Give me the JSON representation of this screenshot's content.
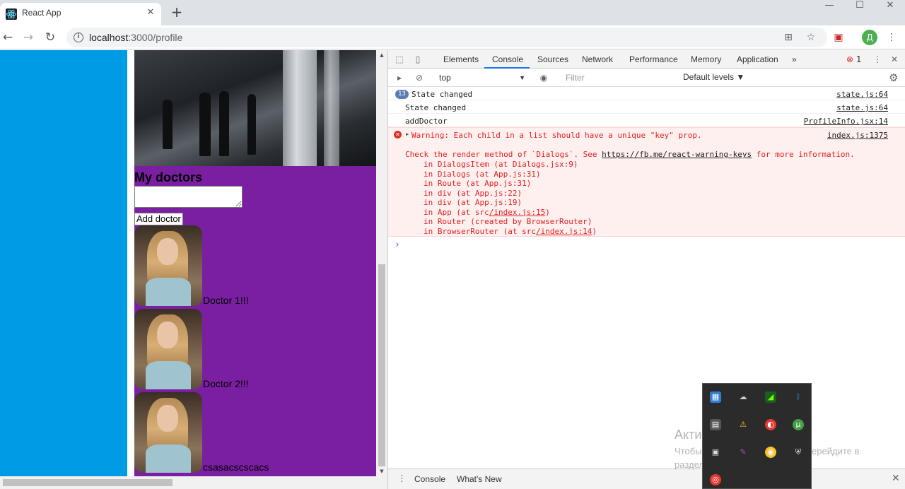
{
  "browser": {
    "tab_title": "React App",
    "tab_close": "✕",
    "new_tab": "+",
    "window_controls": [
      "—",
      "☐",
      "✕"
    ],
    "url_host": "localhost",
    "url_path": ":3000/profile",
    "info_icon": "i",
    "avatar_letter": "Д"
  },
  "page": {
    "title": "My doctors",
    "add_button": "Add doctor",
    "doctors": [
      {
        "name": "Doctor 1!!!"
      },
      {
        "name": "Doctor 2!!!"
      },
      {
        "name": "csasacscscacs"
      }
    ]
  },
  "devtools": {
    "tabs": [
      "Elements",
      "Console",
      "Sources",
      "Network",
      "Performance",
      "Memory",
      "Application"
    ],
    "active_tab": "Console",
    "more_tabs": "»",
    "error_count": "1",
    "context": "top",
    "filter_placeholder": "Filter",
    "levels": "Default levels ▼",
    "messages": [
      {
        "repeat": "13",
        "text": "State changed",
        "source": "state.js:64"
      },
      {
        "text": "State changed",
        "source": "state.js:64"
      },
      {
        "text": "addDoctor",
        "source": "ProfileInfo.jsx:14"
      }
    ],
    "error": {
      "main": "Warning: Each child in a list should have a unique \"key\" prop.",
      "source": "index.js:1375",
      "check_prefix": "Check the render method of `Dialogs`. See ",
      "check_link": "https://fb.me/react-warning-keys",
      "check_suffix": " for more information.",
      "stack": [
        {
          "pre": "in DialogsItem (at Dialogs.jsx:9)",
          "link": ""
        },
        {
          "pre": "in Dialogs (at App.js:31)",
          "link": ""
        },
        {
          "pre": "in Route (at App.js:31)",
          "link": ""
        },
        {
          "pre": "in div (at App.js:22)",
          "link": ""
        },
        {
          "pre": "in div (at App.js:19)",
          "link": ""
        },
        {
          "pre": "in App (at src",
          "link": "/index.js:15",
          "post": ")"
        },
        {
          "pre": "in Router (created by BrowserRouter)",
          "link": ""
        },
        {
          "pre": "in BrowserRouter (at src",
          "link": "/index.js:14",
          "post": ")"
        }
      ]
    },
    "prompt": "›",
    "drawer_tabs": [
      "Console",
      "What's New"
    ],
    "drawer_menu": "⋮",
    "drawer_close": "✕"
  },
  "windows": {
    "watermark_title": "Активация Windows",
    "watermark_text": "Чтобы активировать Windows, перейдите в раздел \"Параметры\"."
  },
  "colors": {
    "left_column": "#009be5",
    "main_column": "#7b1fa2",
    "error_bg": "#fff0f0",
    "error_text": "#e02020",
    "accent": "#1a73e8"
  }
}
